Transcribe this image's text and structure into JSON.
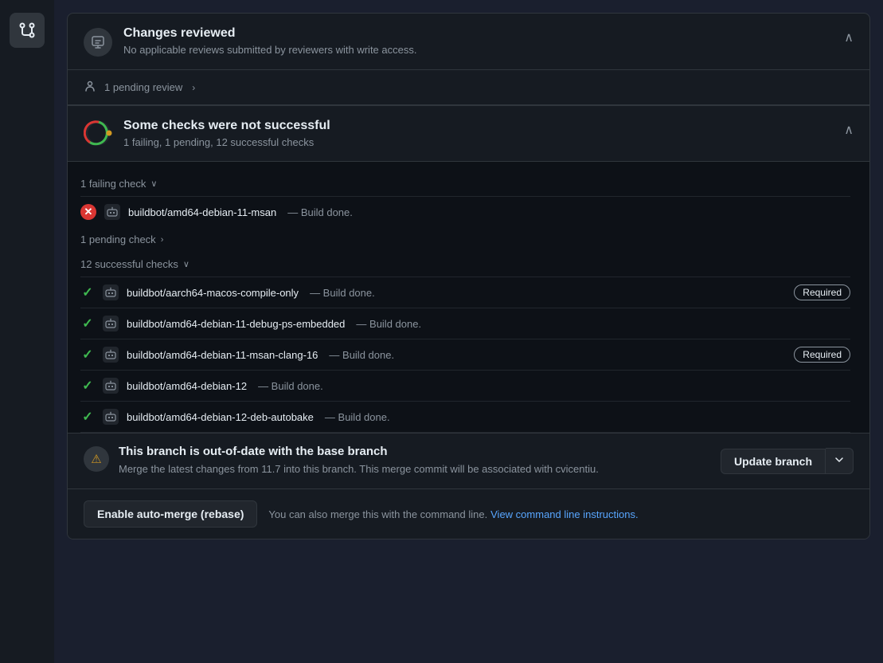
{
  "sidebar": {
    "logo_icon": "git-merge-icon"
  },
  "changes_reviewed": {
    "title": "Changes reviewed",
    "subtitle": "No applicable reviews submitted by reviewers with write access.",
    "collapse_icon": "chevron-up-icon"
  },
  "pending_review": {
    "text": "1 pending review",
    "chevron": "›"
  },
  "checks_section": {
    "title": "Some checks were not successful",
    "subtitle": "1 failing, 1 pending, 12 successful checks"
  },
  "failing_checks": {
    "header": "1 failing check",
    "items": [
      {
        "name": "buildbot/amd64-debian-11-msan",
        "status": "— Build done.",
        "required": false
      }
    ]
  },
  "pending_checks": {
    "header": "1 pending check",
    "chevron": "›"
  },
  "successful_checks": {
    "header": "12 successful checks",
    "items": [
      {
        "name": "buildbot/aarch64-macos-compile-only",
        "status": "— Build done.",
        "required": true,
        "required_label": "Required"
      },
      {
        "name": "buildbot/amd64-debian-11-debug-ps-embedded",
        "status": "— Build done.",
        "required": false
      },
      {
        "name": "buildbot/amd64-debian-11-msan-clang-16",
        "status": "— Build done.",
        "required": true,
        "required_label": "Required"
      },
      {
        "name": "buildbot/amd64-debian-12",
        "status": "— Build done.",
        "required": false
      },
      {
        "name": "buildbot/amd64-debian-12-deb-autobake",
        "status": "— Build done.",
        "required": false
      }
    ]
  },
  "outofdate_banner": {
    "title": "This branch is out-of-date with the base branch",
    "description": "Merge the latest changes from 11.7 into this branch. This merge commit will be associated with cvicentiu.",
    "update_button": "Update branch",
    "dropdown_icon": "chevron-down-icon"
  },
  "automerge_footer": {
    "button_label": "Enable auto-merge (rebase)",
    "text": "You can also merge this with the command line.",
    "link_text": "View command line instructions."
  }
}
